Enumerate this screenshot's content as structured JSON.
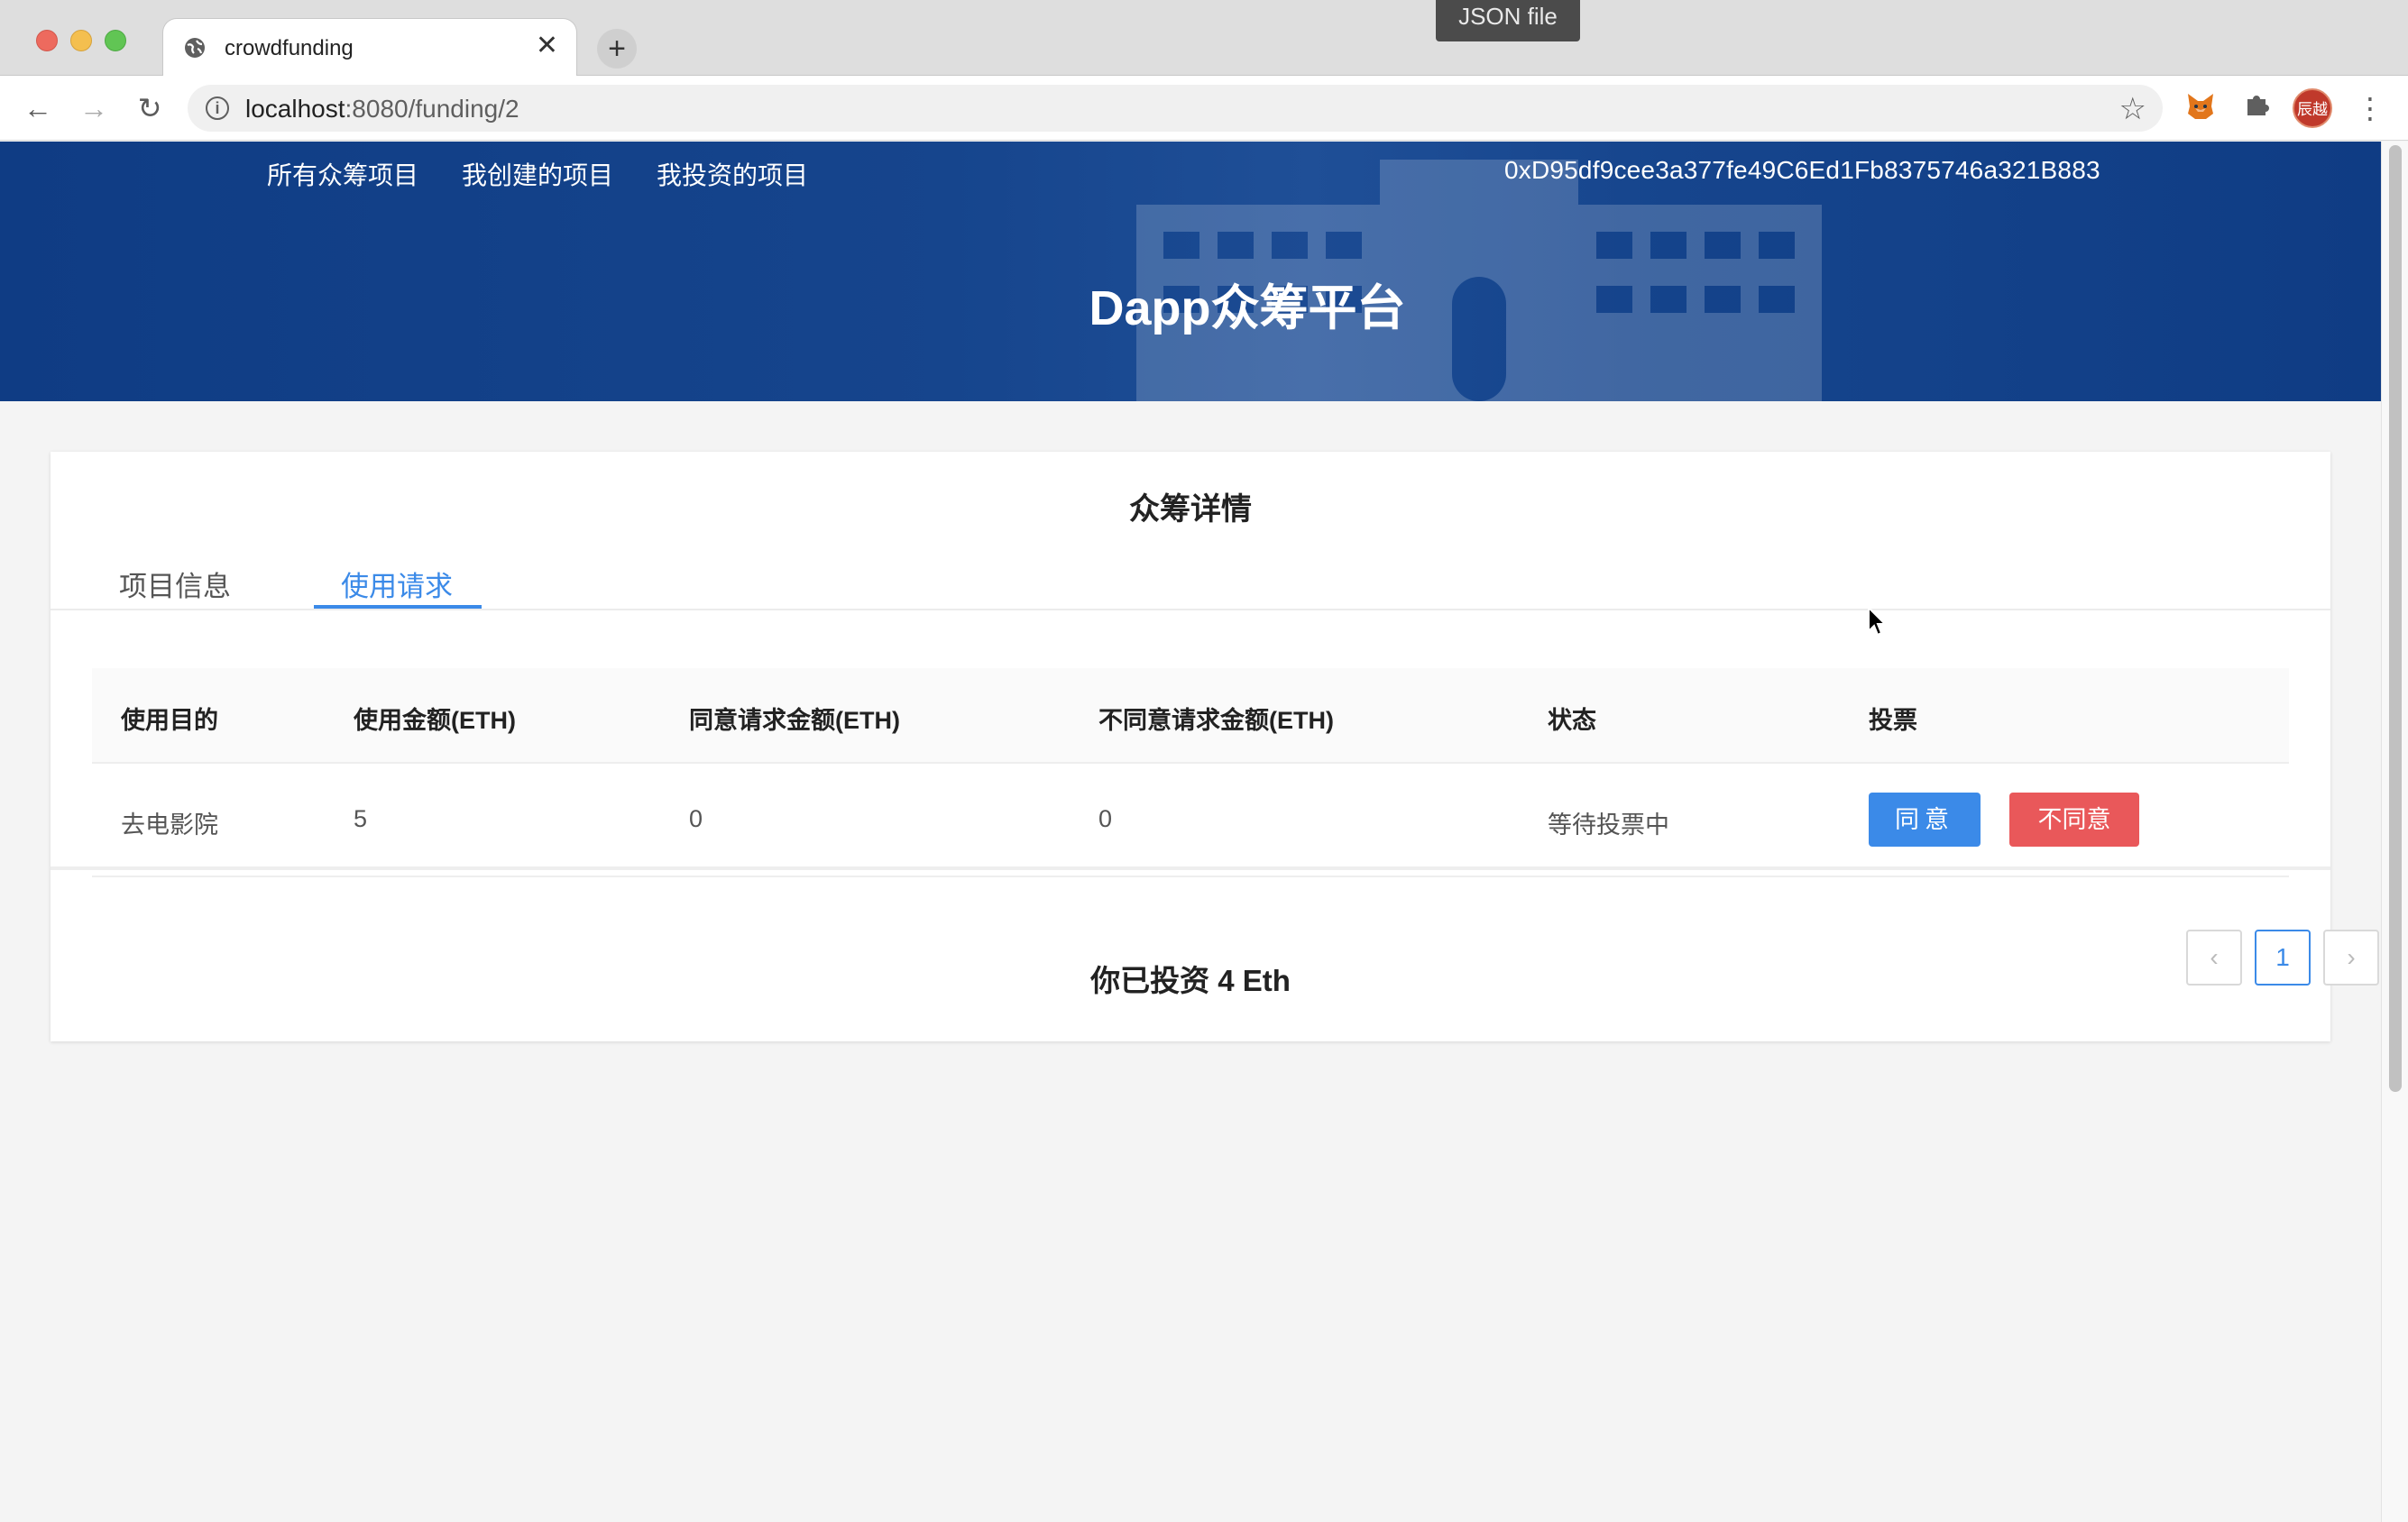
{
  "browser": {
    "tab_title": "crowdfunding",
    "tab_close": "✕",
    "new_tab": "+",
    "tooltip": "JSON file",
    "url_host": "localhost",
    "url_path": ":8080/funding/2",
    "avatar_text": "辰越"
  },
  "header": {
    "nav": [
      "所有众筹项目",
      "我创建的项目",
      "我投资的项目"
    ],
    "account": "0xD95df9cee3a377fe49C6Ed1Fb8375746a321B883",
    "title": "Dapp众筹平台"
  },
  "card": {
    "title": "众筹详情",
    "tabs": [
      "项目信息",
      "使用请求"
    ],
    "active_tab": "使用请求",
    "columns": [
      "使用目的",
      "使用金额(ETH)",
      "同意请求金额(ETH)",
      "不同意请求金额(ETH)",
      "状态",
      "投票"
    ],
    "rows": [
      {
        "purpose": "去电影院",
        "amount": "5",
        "agree_amount": "0",
        "disagree_amount": "0",
        "status": "等待投票中",
        "agree_label": "同意",
        "disagree_label": "不同意"
      }
    ],
    "pagination": {
      "prev": "‹",
      "current": "1",
      "next": "›"
    },
    "invested_text": "你已投资 4 Eth"
  },
  "colors": {
    "brand_blue": "#0f3c84",
    "accent": "#3b8ae8",
    "danger": "#e9585a"
  }
}
